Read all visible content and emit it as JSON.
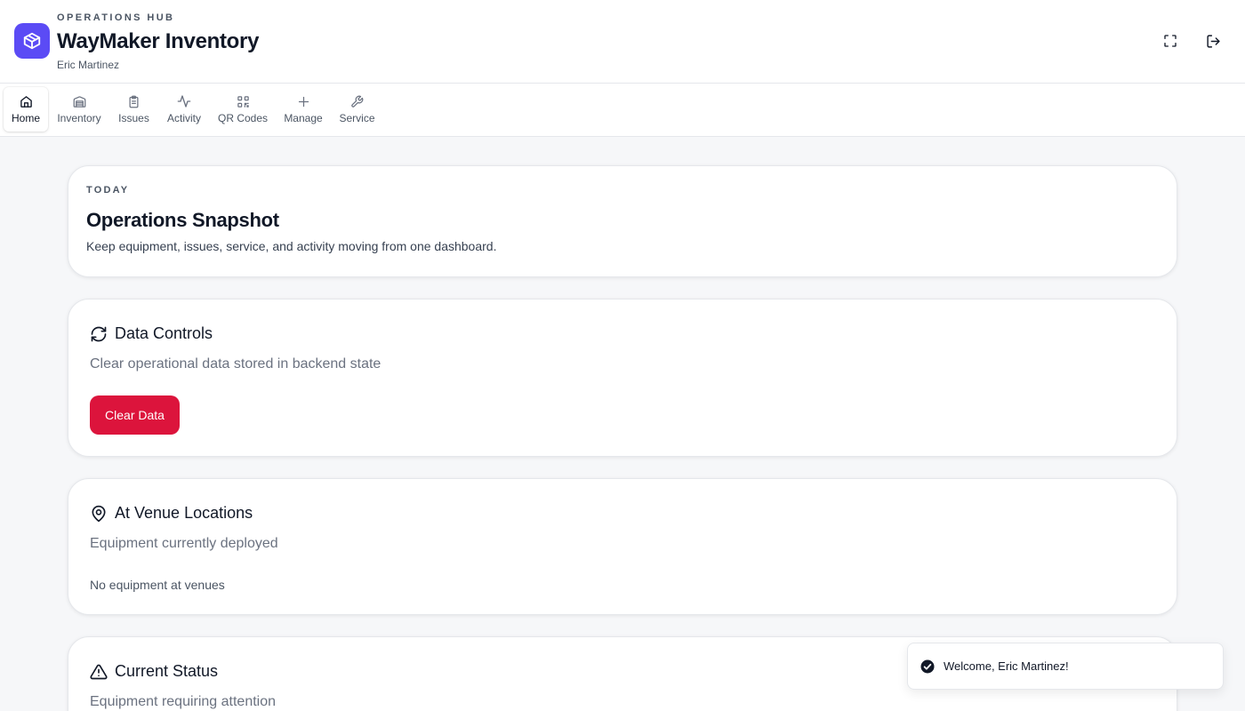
{
  "header": {
    "eyebrow": "OPERATIONS HUB",
    "title": "WayMaker Inventory",
    "user": "Eric Martinez",
    "logo_icon": "package-icon",
    "brand_color": "#5b4bf5",
    "actions": [
      {
        "name": "fullscreen-icon"
      },
      {
        "name": "logout-icon"
      }
    ]
  },
  "nav": {
    "active": "Home",
    "items": [
      {
        "label": "Home",
        "icon": "home-icon"
      },
      {
        "label": "Inventory",
        "icon": "warehouse-icon"
      },
      {
        "label": "Issues",
        "icon": "clipboard-icon"
      },
      {
        "label": "Activity",
        "icon": "activity-icon"
      },
      {
        "label": "QR Codes",
        "icon": "qr-code-icon"
      },
      {
        "label": "Manage",
        "icon": "plus-icon"
      },
      {
        "label": "Service",
        "icon": "wrench-icon"
      }
    ]
  },
  "snapshot": {
    "eyebrow": "TODAY",
    "title": "Operations Snapshot",
    "subtitle": "Keep equipment, issues, service, and activity moving from one dashboard."
  },
  "data_controls": {
    "icon": "refresh-icon",
    "title": "Data Controls",
    "description": "Clear operational data stored in backend state",
    "button_label": "Clear Data",
    "button_color": "#dc143c"
  },
  "venue_locations": {
    "icon": "map-pin-icon",
    "title": "At Venue Locations",
    "description": "Equipment currently deployed",
    "empty_text": "No equipment at venues"
  },
  "current_status": {
    "icon": "alert-triangle-icon",
    "title": "Current Status",
    "description": "Equipment requiring attention"
  },
  "toast": {
    "icon": "check-circle-icon",
    "message": "Welcome, Eric Martinez!"
  }
}
